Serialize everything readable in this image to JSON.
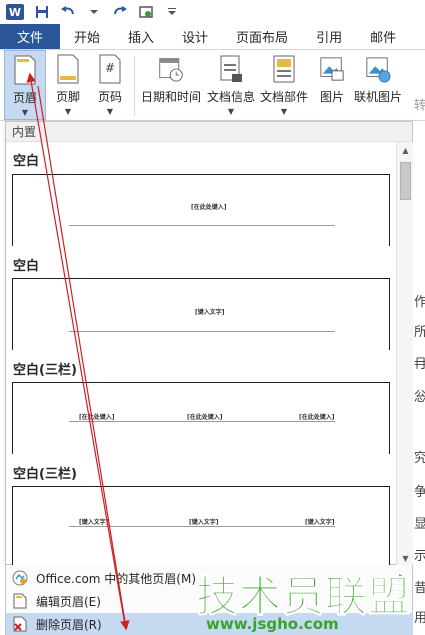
{
  "qat": {
    "word_logo": "W",
    "icons": [
      "save-icon",
      "undo-icon",
      "redo-icon",
      "touch-mode-icon",
      "customize-icon"
    ]
  },
  "tabs": [
    "文件",
    "开始",
    "插入",
    "设计",
    "页面布局",
    "引用",
    "邮件"
  ],
  "ribbon": {
    "buttons": {
      "header": "页眉",
      "footer": "页脚",
      "page_number": "页码",
      "date_time": "日期和时间",
      "doc_info": "文档信息",
      "doc_parts": "文档部件",
      "picture": "图片",
      "online_picture": "联机图片",
      "truncated": "转"
    }
  },
  "gallery": {
    "section": "内置",
    "items": [
      {
        "title": "空白",
        "placeholders": [
          "[在此处键入]"
        ]
      },
      {
        "title": "空白",
        "placeholders": [
          "[键入文字]"
        ]
      },
      {
        "title": "空白(三栏)",
        "placeholders": [
          "[在此处键入]",
          "[在此处键入]",
          "[在此处键入]"
        ]
      },
      {
        "title": "空白(三栏)",
        "placeholders": [
          "[键入文字]",
          "[键入文字]",
          "[键入文字]"
        ]
      }
    ]
  },
  "menu": {
    "more": "Office.com 中的其他页眉(M)",
    "edit": "编辑页眉(E)",
    "remove": "删除页眉(R)"
  },
  "doc_chars": [
    "作",
    "所",
    "冄",
    "忩",
    "究",
    "争",
    "显",
    "示",
    "昔",
    "用"
  ],
  "watermark": {
    "big": "技术员联盟",
    "small": "www.jsgho.com"
  },
  "colors": {
    "accent": "#2b579a",
    "hover": "#c5d9f1",
    "annotation": "#cc2222",
    "watermark": "#3aa329"
  }
}
